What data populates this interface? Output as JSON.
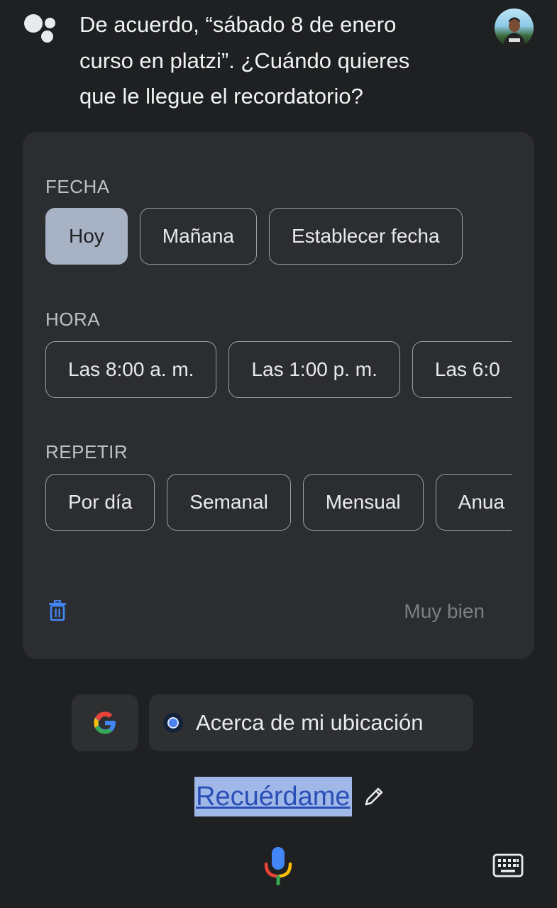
{
  "assistant": {
    "message_lines": [
      "De acuerdo, “sábado 8 de enero",
      "curso en platzi”. ¿Cuándo quieres",
      "que le llegue el recordatorio?"
    ]
  },
  "reminder_card": {
    "date_section": {
      "label": "FECHA",
      "options": [
        "Hoy",
        "Mañana",
        "Establecer fecha"
      ],
      "selected": "Hoy"
    },
    "time_section": {
      "label": "HORA",
      "options": [
        "Las 8:00 a. m.",
        "Las 1:00 p. m.",
        "Las 6:0"
      ]
    },
    "repeat_section": {
      "label": "REPETIR",
      "options": [
        "Por día",
        "Semanal",
        "Mensual",
        "Anua"
      ]
    },
    "ok_label": "Muy bien"
  },
  "suggestions": {
    "location_chip": "Acerca de mi ubicación"
  },
  "query": {
    "text": "Recuérdame"
  },
  "colors": {
    "background": "#1f2022",
    "card": "#2c2d30",
    "selected_chip": "#a8b2c5",
    "accent_blue": "#4285f4"
  }
}
